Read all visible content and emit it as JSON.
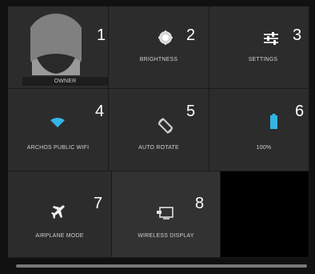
{
  "tiles": {
    "owner": {
      "number": "1",
      "label": "OWNER"
    },
    "brightness": {
      "number": "2",
      "label": "BRIGHTNESS"
    },
    "settings": {
      "number": "3",
      "label": "SETTINGS"
    },
    "wifi": {
      "number": "4",
      "label": "ARCHOS PUBLIC WIFI"
    },
    "auto_rotate": {
      "number": "5",
      "label": "AUTO ROTATE"
    },
    "battery": {
      "number": "6",
      "label": "100%"
    },
    "airplane": {
      "number": "7",
      "label": "AIRPLANE MODE"
    },
    "wireless_display": {
      "number": "8",
      "label": "WIRELESS DISPLAY"
    }
  },
  "colors": {
    "accent": "#33b5e5",
    "tile_bg": "#2c2c2c",
    "text": "#ffffff"
  },
  "icons": {
    "owner": "avatar",
    "brightness": "brightness-icon",
    "settings": "settings-sliders-icon",
    "wifi": "wifi-icon",
    "auto_rotate": "rotate-icon",
    "battery": "battery-icon",
    "airplane": "airplane-icon",
    "wireless_display": "cast-screen-icon"
  }
}
